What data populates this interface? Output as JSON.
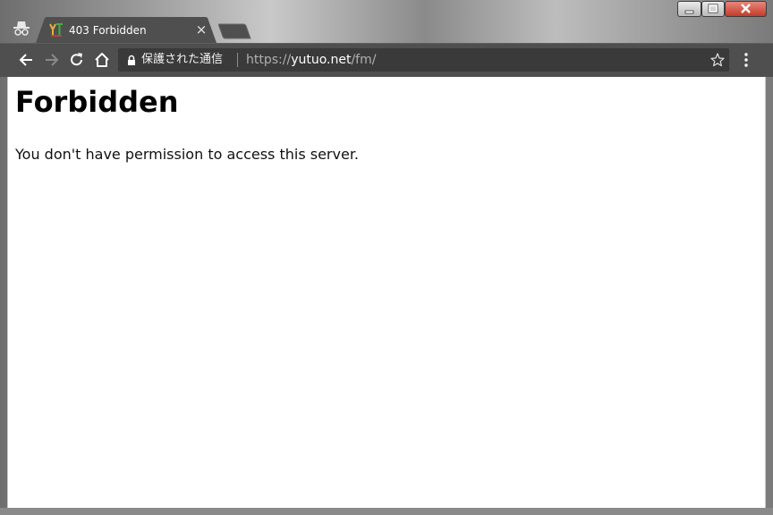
{
  "browser": {
    "tab": {
      "title": "403 Forbidden",
      "favicon_text": "YT",
      "close_symbol": "×"
    },
    "omnibox": {
      "secure_label": "保護された通信",
      "url_scheme": "https://",
      "url_host": "yutuo.net",
      "url_path": "/fm/"
    },
    "icons": [
      "incognito-icon",
      "favicon",
      "close-icon",
      "new-tab",
      "minimize-icon",
      "maximize-icon",
      "window-close-icon",
      "back-arrow-icon",
      "forward-arrow-icon",
      "reload-icon",
      "home-icon",
      "lock-icon",
      "star-icon",
      "kebab-menu-icon"
    ]
  },
  "page": {
    "heading": "Forbidden",
    "message": "You don't have permission to access this server."
  },
  "colors": {
    "toolbar": "#4f4f4f",
    "tab": "#4f4f4f",
    "omnibox": "#3a3a3a",
    "close_button": "#c33b2a",
    "page_background": "#ffffff"
  }
}
